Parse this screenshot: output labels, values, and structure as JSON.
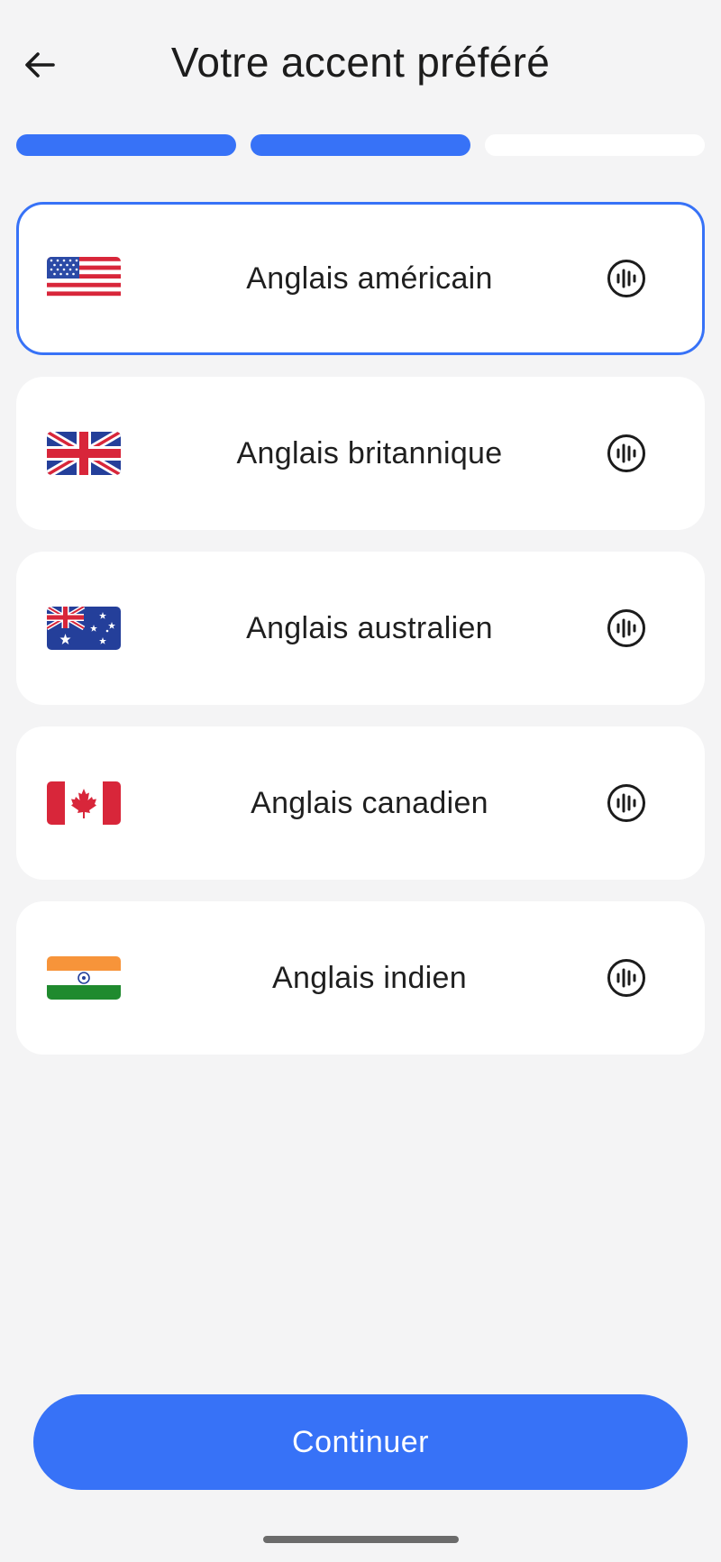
{
  "header": {
    "title": "Votre accent préféré",
    "back_icon": "arrow-left-icon"
  },
  "progress": {
    "total_steps": 3,
    "completed_steps": 2,
    "active_color": "#3772f7",
    "inactive_color": "#ffffff"
  },
  "options": [
    {
      "label": "Anglais américain",
      "flag": "us-flag-icon",
      "selected": true,
      "audio_icon": "audio-wave-icon"
    },
    {
      "label": "Anglais britannique",
      "flag": "uk-flag-icon",
      "selected": false,
      "audio_icon": "audio-wave-icon"
    },
    {
      "label": "Anglais australien",
      "flag": "australia-flag-icon",
      "selected": false,
      "audio_icon": "audio-wave-icon"
    },
    {
      "label": "Anglais canadien",
      "flag": "canada-flag-icon",
      "selected": false,
      "audio_icon": "audio-wave-icon"
    },
    {
      "label": "Anglais indien",
      "flag": "india-flag-icon",
      "selected": false,
      "audio_icon": "audio-wave-icon"
    }
  ],
  "continue_button": {
    "label": "Continuer"
  },
  "colors": {
    "accent": "#3772f7",
    "background": "#f4f4f5",
    "card": "#ffffff"
  }
}
